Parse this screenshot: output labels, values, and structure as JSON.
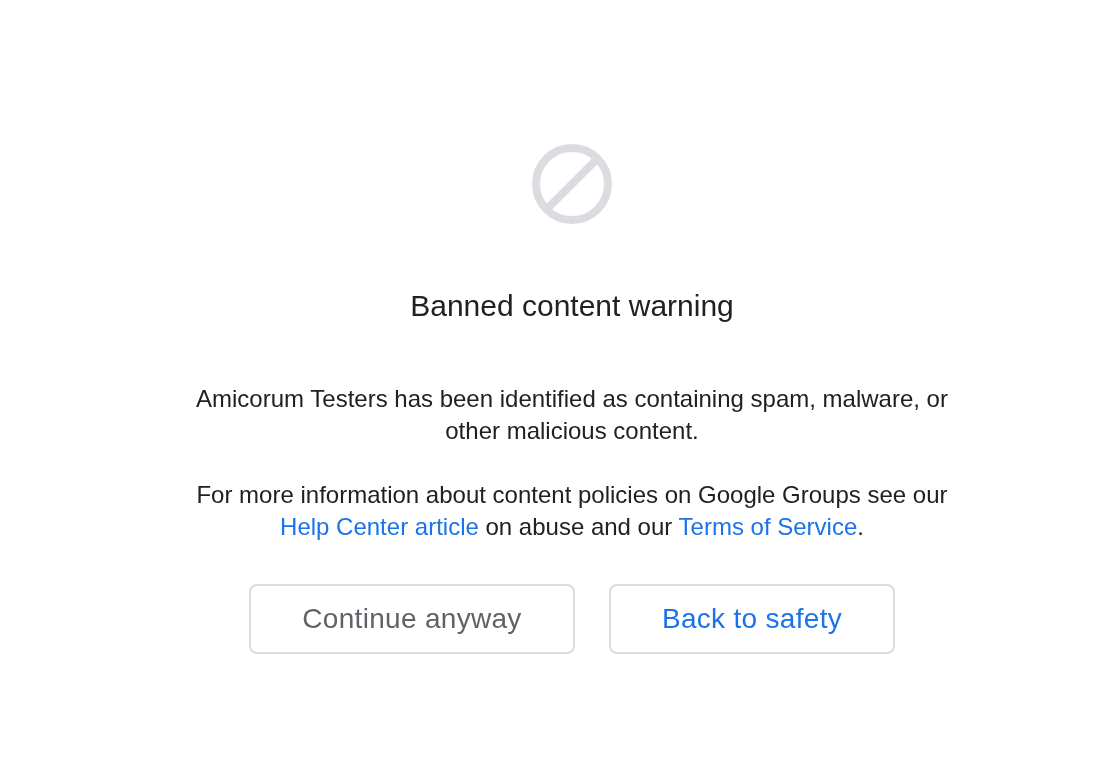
{
  "title": "Banned content warning",
  "message": "Amicorum Testers has been identified as containing spam, malware, or other malicious content.",
  "info": [
    {
      "kind": "text",
      "text": "For more information about content policies on Google Groups see our "
    },
    {
      "kind": "link",
      "text": "Help Center article"
    },
    {
      "kind": "text",
      "text": " on abuse and our "
    },
    {
      "kind": "link",
      "text": "Terms of Service"
    },
    {
      "kind": "text",
      "text": "."
    }
  ],
  "buttons": [
    {
      "kind": "secondary",
      "label": "Continue anyway"
    },
    {
      "kind": "primary",
      "label": "Back to safety"
    }
  ]
}
